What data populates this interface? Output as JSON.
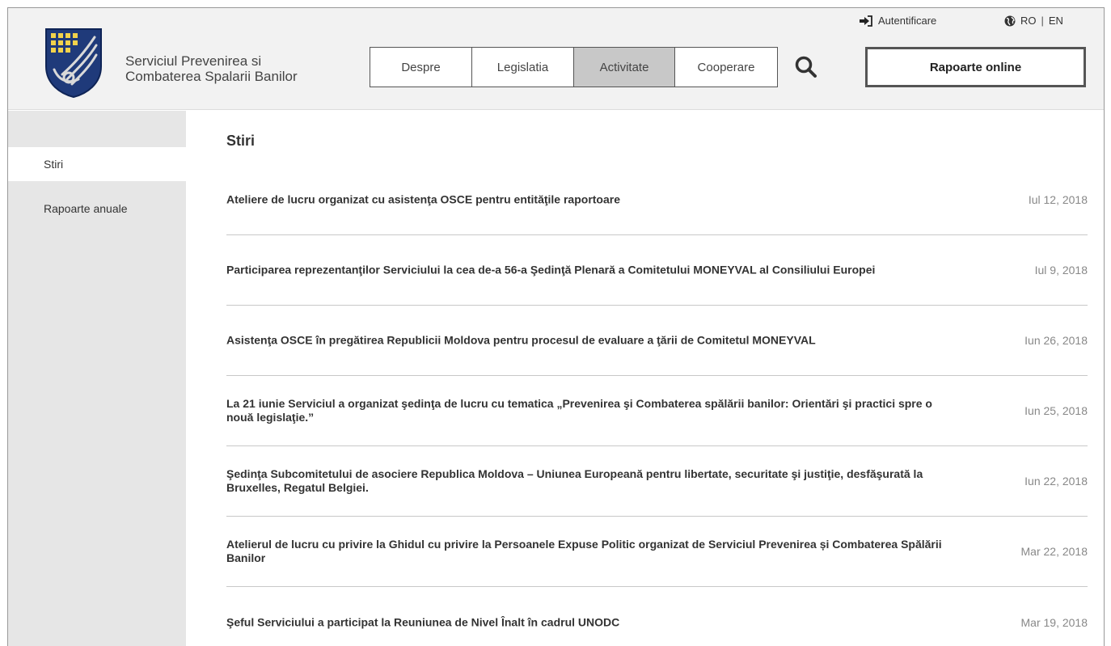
{
  "header": {
    "site_name_line1": "Serviciul Prevenirea si",
    "site_name_line2": "Combaterea Spalarii Banilor",
    "login_label": "Autentificare",
    "lang_ro": "RO",
    "lang_sep": "|",
    "lang_en": "EN",
    "nav": [
      {
        "label": "Despre",
        "active": false
      },
      {
        "label": "Legislatia",
        "active": false
      },
      {
        "label": "Activitate",
        "active": true
      },
      {
        "label": "Cooperare",
        "active": false
      }
    ],
    "reports_button": "Rapoarte online"
  },
  "sidebar": {
    "items": [
      {
        "label": "Stiri",
        "active": true
      },
      {
        "label": "Rapoarte anuale",
        "active": false
      }
    ]
  },
  "main": {
    "title": "Stiri",
    "news": [
      {
        "title": "Ateliere de lucru organizat cu asistenţa OSCE pentru entităţile raportoare",
        "date": "Iul 12, 2018"
      },
      {
        "title": "Participarea reprezentanţilor Serviciului la cea de-a 56-a Şedinţă Plenară a Comitetului MONEYVAL al Consiliului Europei",
        "date": "Iul 9, 2018"
      },
      {
        "title": "Asistenţa OSCE în pregătirea Republicii Moldova pentru procesul de evaluare a ţării de Comitetul MONEYVAL",
        "date": "Iun 26, 2018"
      },
      {
        "title": "La 21 iunie Serviciul a organizat şedinţa de lucru cu tematica „Prevenirea şi Combaterea spălării banilor: Orientări şi practici spre o nouă legislaţie.”",
        "date": "Iun 25, 2018"
      },
      {
        "title": "Şedinţa Subcomitetului de asociere Republica Moldova – Uniunea Europeană pentru libertate, securitate şi justiţie, desfăşurată la Bruxelles, Regatul Belgiei.",
        "date": "Iun 22, 2018"
      },
      {
        "title": "Atelierul de lucru cu privire la Ghidul cu privire la Persoanele Expuse Politic organizat de Serviciul Prevenirea și Combaterea Spălării Banilor",
        "date": "Mar 22, 2018"
      },
      {
        "title": "Şeful Serviciului a participat la Reuniunea de Nivel Înalt în cadrul UNODC",
        "date": "Mar 19, 2018"
      }
    ]
  },
  "colors": {
    "header_bg": "#f2f2f2",
    "sidebar_bg": "#e6e6e6",
    "nav_active_bg": "#c8c8c8",
    "logo_blue": "#1f3a7a",
    "logo_gold": "#f2d24b"
  },
  "icons": {
    "logo": "coat-of-arms-logo",
    "login": "sign-in-icon",
    "language": "globe-icon",
    "search": "search-icon"
  }
}
